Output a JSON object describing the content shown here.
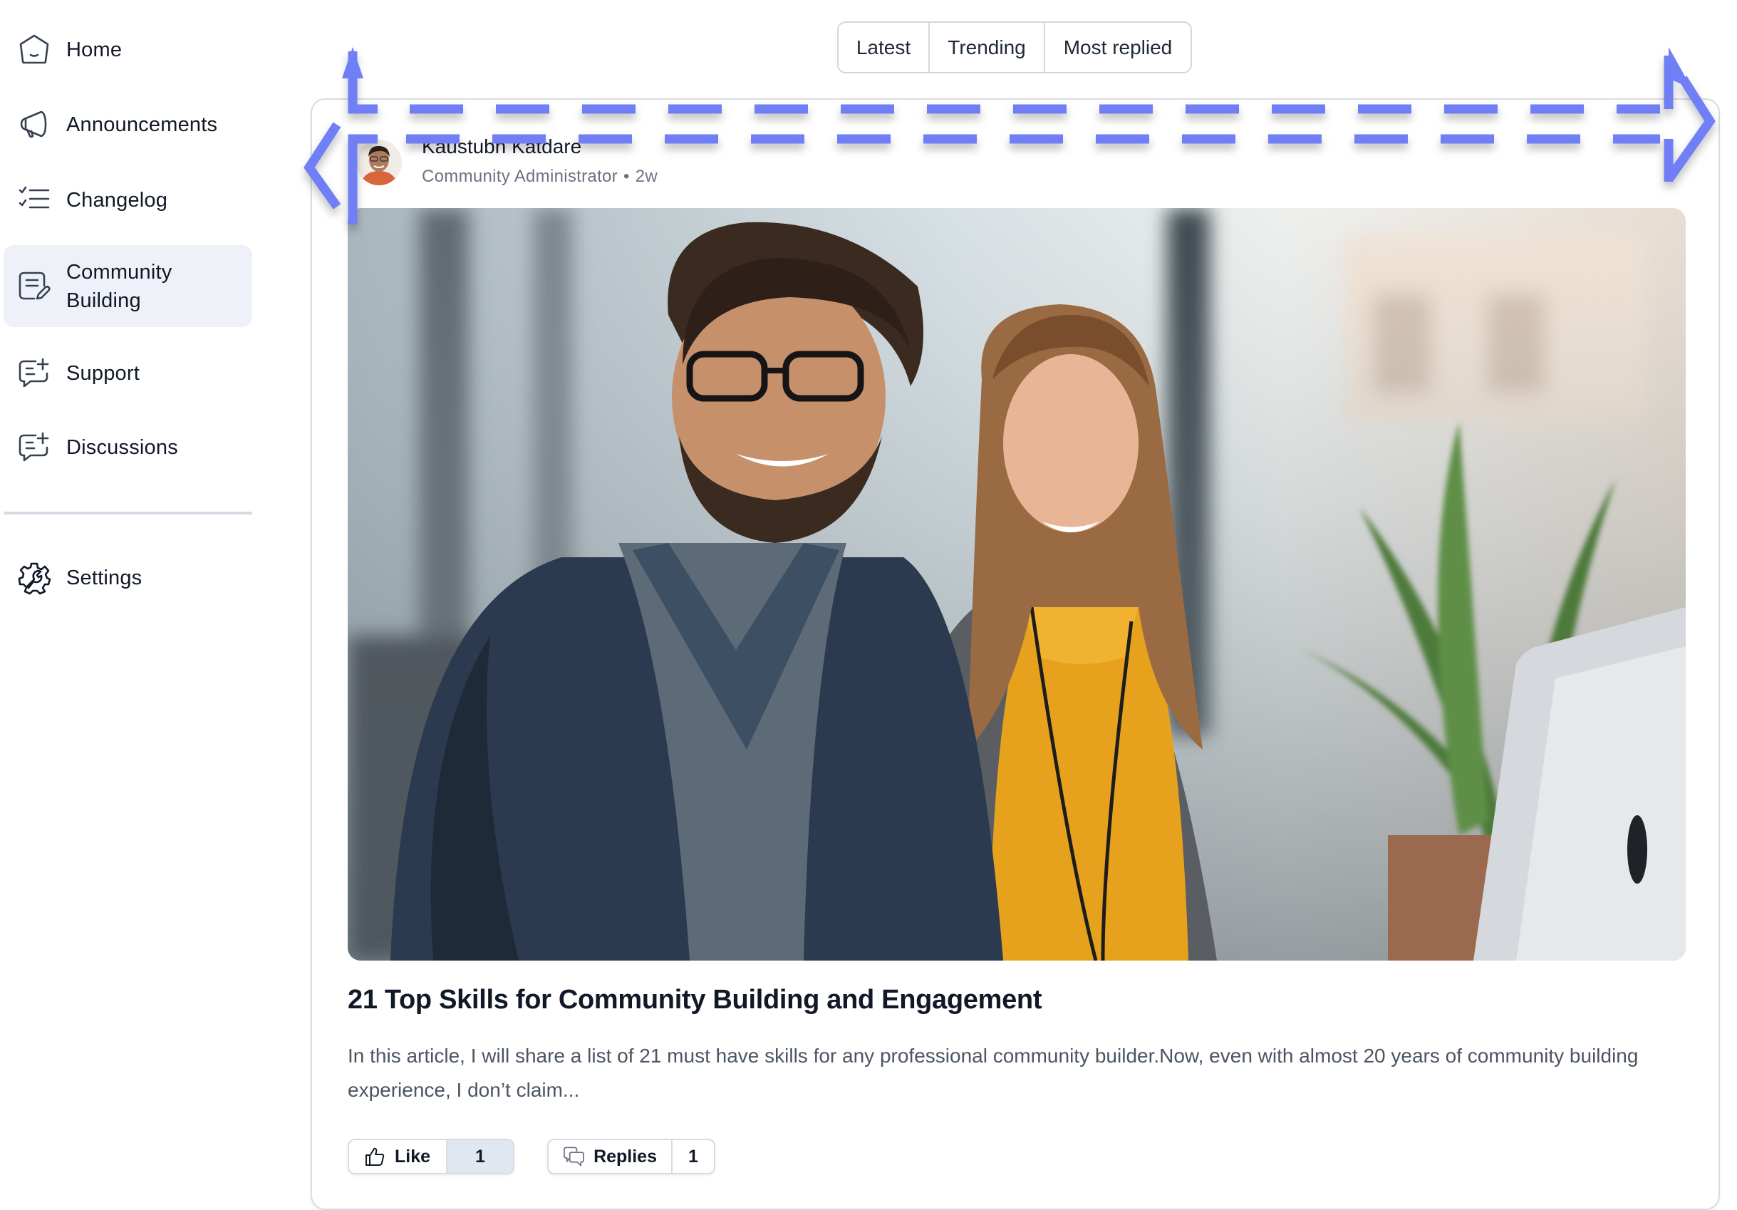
{
  "sidebar": {
    "items": [
      {
        "label": "Home",
        "icon": "home-icon",
        "active": false
      },
      {
        "label": "Announcements",
        "icon": "megaphone-icon",
        "active": false
      },
      {
        "label": "Changelog",
        "icon": "checklist-icon",
        "active": false
      },
      {
        "label": "Community\nBuilding",
        "label_line1": "Community",
        "label_line2": "Building",
        "icon": "note-edit-icon",
        "active": true
      },
      {
        "label": "Support",
        "icon": "chat-add-icon",
        "active": false
      },
      {
        "label": "Discussions",
        "icon": "chat-add-icon",
        "active": false
      }
    ],
    "footer_items": [
      {
        "label": "Settings",
        "icon": "settings-gear-wrench-icon"
      }
    ]
  },
  "sort_tabs": [
    {
      "label": "Latest"
    },
    {
      "label": "Trending"
    },
    {
      "label": "Most replied"
    }
  ],
  "post": {
    "author": {
      "name": "Kaustubh Katdare",
      "role": "Community Administrator",
      "separator": "•",
      "time": "2w"
    },
    "image_alt": "Two smiling colleagues in an office",
    "title": "21 Top Skills for Community Building and Engagement",
    "excerpt": "In this article, I will share a list of 21 must have skills for any professional community builder.Now, even with almost 20 years of community building experience, I don’t claim...",
    "actions": {
      "like_label": "Like",
      "like_count": "1",
      "replies_label": "Replies",
      "replies_count": "1"
    }
  },
  "overlay": {
    "type": "horizontal-scroll-indicator",
    "color": "#6f7ff5"
  },
  "colors": {
    "active_nav_bg": "#eef2f8",
    "border": "#d7dce3",
    "like_count_bg": "#e1e7f1",
    "text_primary": "#111827",
    "text_muted": "#6b7280"
  }
}
